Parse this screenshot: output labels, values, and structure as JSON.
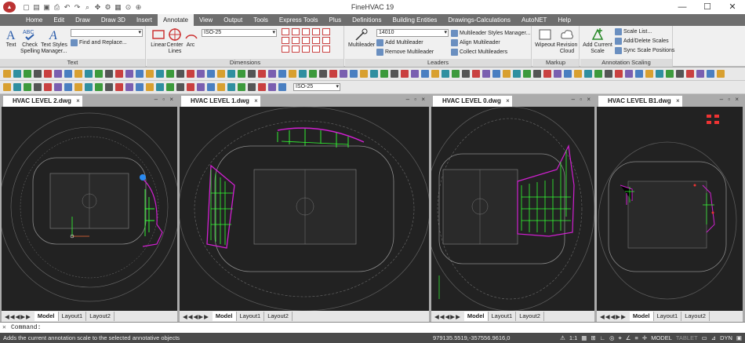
{
  "app": {
    "title": "FineHVAC 19",
    "logo_text": "▲"
  },
  "window_controls": [
    "—",
    "☐",
    "✕"
  ],
  "menu": [
    "Home",
    "Edit",
    "Draw",
    "Draw 3D",
    "Insert",
    "Annotate",
    "View",
    "Output",
    "Tools",
    "Express Tools",
    "Plus",
    "Definitions",
    "Building Entities",
    "Drawings-Calculations",
    "AutoNET",
    "Help"
  ],
  "active_menu": "Annotate",
  "ribbon": {
    "text_group": {
      "label": "Text",
      "text": "Text",
      "check_spelling": "Check\nSpelling",
      "text_styles": "Text Styles\nManager...",
      "find_replace": "Find and Replace..."
    },
    "dimensions_group": {
      "label": "Dimensions",
      "linear": "Linear",
      "center_lines": "Center\nLines",
      "arc": "Arc",
      "dimstyle": "ISO-25"
    },
    "leaders_group": {
      "label": "Leaders",
      "multileader": "Multileader",
      "value": "14010",
      "styles_manager": "Multileader Styles Manager...",
      "add": "Add Multileader",
      "remove": "Remove Multileader",
      "align": "Align Multileader",
      "collect": "Collect Multileaders"
    },
    "markup_group": {
      "label": "Markup",
      "wipeout": "Wipeout",
      "revision_cloud": "Revision\nCloud"
    },
    "scaling_group": {
      "label": "Annotation Scaling",
      "add_current": "Add Current\nScale",
      "scale_list": "Scale List...",
      "add_delete": "Add/Delete Scales",
      "sync": "Sync Scale Positions"
    }
  },
  "toolbar_combo": "ISO-25",
  "viewports": [
    {
      "tab": "HVAC LEVEL 2.dwg",
      "layouts": [
        "Model",
        "Layout1",
        "Layout2"
      ]
    },
    {
      "tab": "HVAC LEVEL 1.dwg",
      "layouts": [
        "Model",
        "Layout1",
        "Layout2"
      ]
    },
    {
      "tab": "HVAC LEVEL 0.dwg",
      "layouts": [
        "Model",
        "Layout1",
        "Layout2"
      ]
    },
    {
      "tab": "HVAC LEVEL B1.dwg",
      "layouts": [
        "Model",
        "Layout1",
        "Layout2"
      ]
    }
  ],
  "command": {
    "prompt": "Command:",
    "value": ""
  },
  "status": {
    "message": "Adds the current annotation scale to the selected annotative objects",
    "coords": "979135.5519,-357556.9616,0",
    "scale": "1:1",
    "model": "MODEL",
    "tablet": "TABLET",
    "dyn": "DYN"
  },
  "colors": {
    "menubar": "#6e6e6e",
    "canvas": "#222222",
    "hvac_green": "#33ff33",
    "hvac_magenta": "#d020d0"
  }
}
